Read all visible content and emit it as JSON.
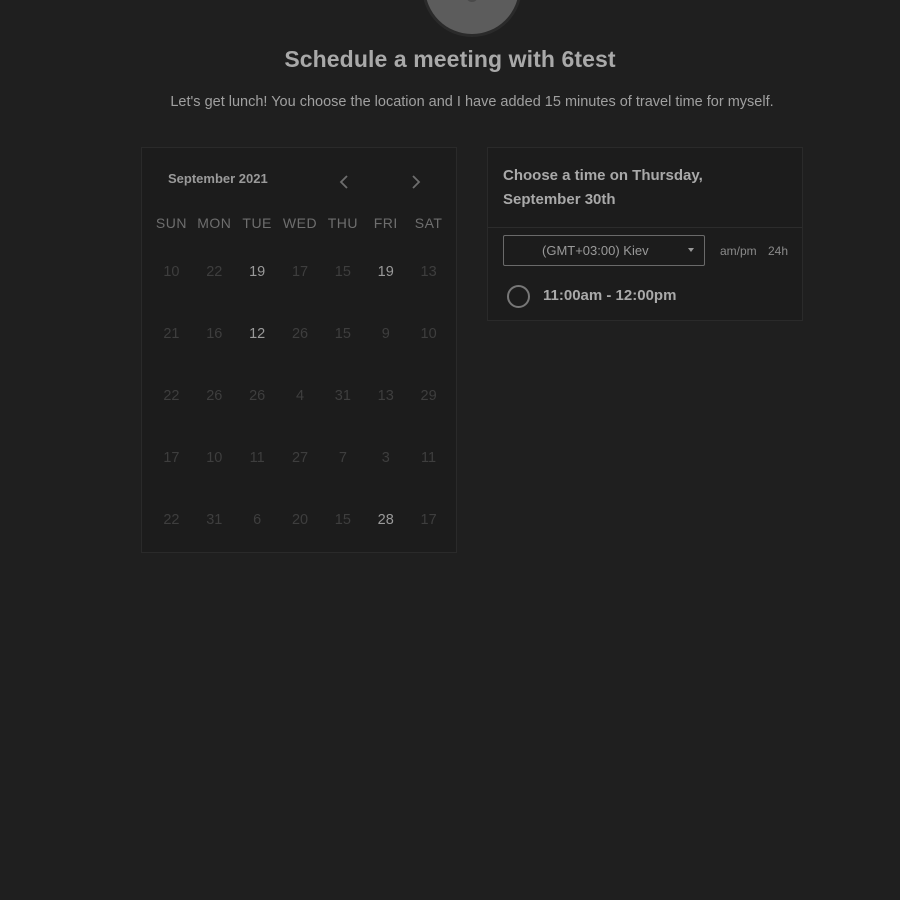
{
  "header": {
    "title": "Schedule a meeting with 6test",
    "description": "Let's get lunch! You choose the location and I have added 15 minutes of travel time for myself."
  },
  "calendar": {
    "month_label": "September 2021",
    "prev_icon": "chevron-left-icon",
    "next_icon": "chevron-right-icon",
    "weekdays": [
      "SUN",
      "MON",
      "TUE",
      "WED",
      "THU",
      "FRI",
      "SAT"
    ],
    "weeks": [
      [
        "10",
        "22",
        "19",
        "17",
        "15",
        "19",
        "13"
      ],
      [
        "21",
        "16",
        "12",
        "26",
        "15",
        "9",
        "10"
      ],
      [
        "22",
        "26",
        "26",
        "4",
        "31",
        "13",
        "29"
      ],
      [
        "17",
        "10",
        "11",
        "27",
        "7",
        "3",
        "11"
      ],
      [
        "22",
        "31",
        "6",
        "20",
        "15",
        "28",
        "17"
      ]
    ],
    "available": [
      [
        0,
        2
      ],
      [
        0,
        5
      ],
      [
        1,
        2
      ],
      [
        4,
        5
      ]
    ]
  },
  "times": {
    "heading": "Choose a time on Thursday, September 30th",
    "timezone": "(GMT+03:00) Kiev",
    "format_ampm": "am/pm",
    "format_24h": "24h",
    "slots": [
      "11:00am - 12:00pm"
    ]
  },
  "colors": {
    "background": "#1f1f1f",
    "card": "#1c1c1c",
    "text": "#a9a9a9"
  }
}
